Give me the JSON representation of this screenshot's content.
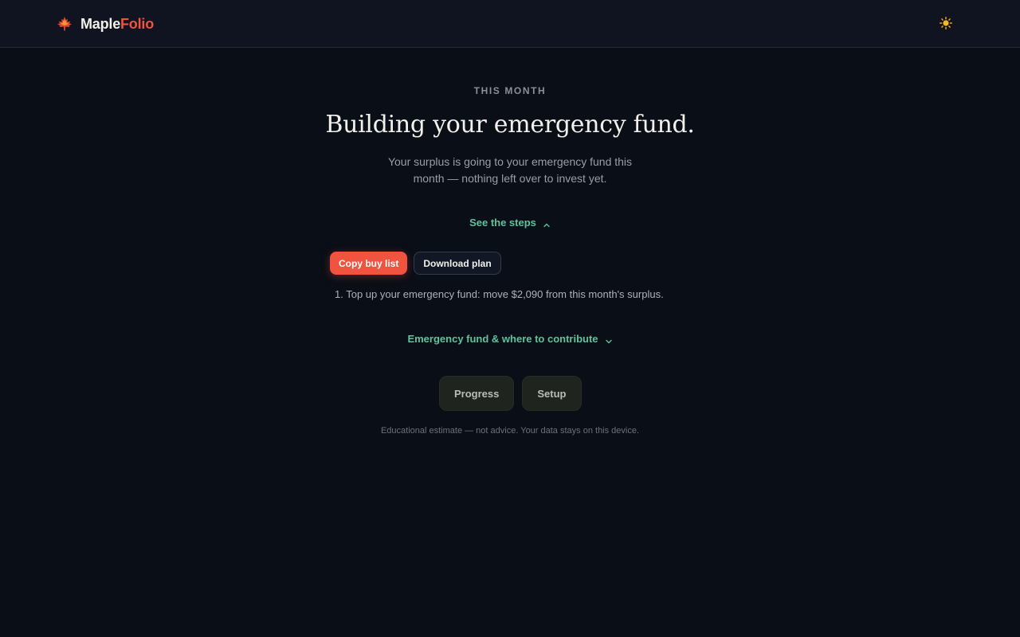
{
  "header": {
    "brand_part_a": "Maple",
    "brand_part_b": "Folio",
    "logo_icon": "maple-leaf-icon",
    "theme_icon": "sun-icon"
  },
  "hero": {
    "eyebrow": "THIS MONTH",
    "title": "Building your emergency fund.",
    "subtitle": "Your surplus is going to your emergency fund this month — nothing left over to invest yet."
  },
  "steps_toggle": {
    "label": "See the steps",
    "state": "expanded"
  },
  "actions": {
    "copy_label": "Copy buy list",
    "download_label": "Download plan"
  },
  "steps": [
    "1. Top up your emergency fund: move $2,090 from this month's surplus."
  ],
  "emergency_toggle": {
    "label": "Emergency fund & where to contribute",
    "state": "collapsed"
  },
  "nav": {
    "progress_label": "Progress",
    "setup_label": "Setup"
  },
  "footer": {
    "disclaimer": "Educational estimate — not advice. Your data stays on this device."
  },
  "colors": {
    "accent": "#f0533e",
    "link": "#5fc29a",
    "background": "#0a0e17"
  }
}
